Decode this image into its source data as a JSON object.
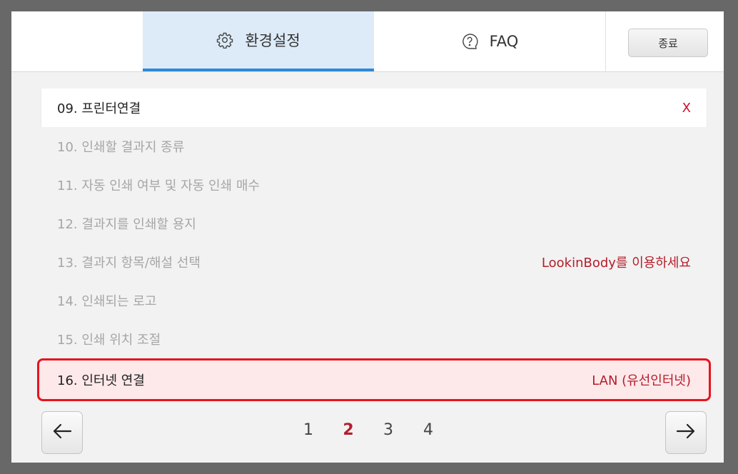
{
  "tabs": {
    "settings_label": "환경설정",
    "faq_label": "FAQ"
  },
  "exit_label": "종료",
  "items": [
    {
      "label": "09. 프린터연결",
      "value": "X"
    },
    {
      "label": "10. 인쇄할 결과지 종류",
      "value": ""
    },
    {
      "label": "11. 자동 인쇄 여부 및 자동 인쇄 매수",
      "value": ""
    },
    {
      "label": "12. 결과지를 인쇄할 용지",
      "value": ""
    },
    {
      "label": "13. 결과지 항목/해설 선택",
      "value": "LookinBody를 이용하세요"
    },
    {
      "label": "14. 인쇄되는 로고",
      "value": ""
    },
    {
      "label": "15. 인쇄 위치 조절",
      "value": ""
    },
    {
      "label": "16. 인터넷 연결",
      "value": "LAN (유선인터넷)"
    }
  ],
  "pagination": {
    "pages": [
      "1",
      "2",
      "3",
      "4"
    ],
    "current": "2"
  },
  "colors": {
    "accent_blue": "#2e8ad6",
    "tab_active_bg": "#ddebf8",
    "highlight_red": "#e8131d",
    "text_red": "#b41e2a"
  },
  "icons": {
    "settings": "gear-icon",
    "faq": "question-icon",
    "prev": "arrow-left-icon",
    "next": "arrow-right-icon"
  }
}
